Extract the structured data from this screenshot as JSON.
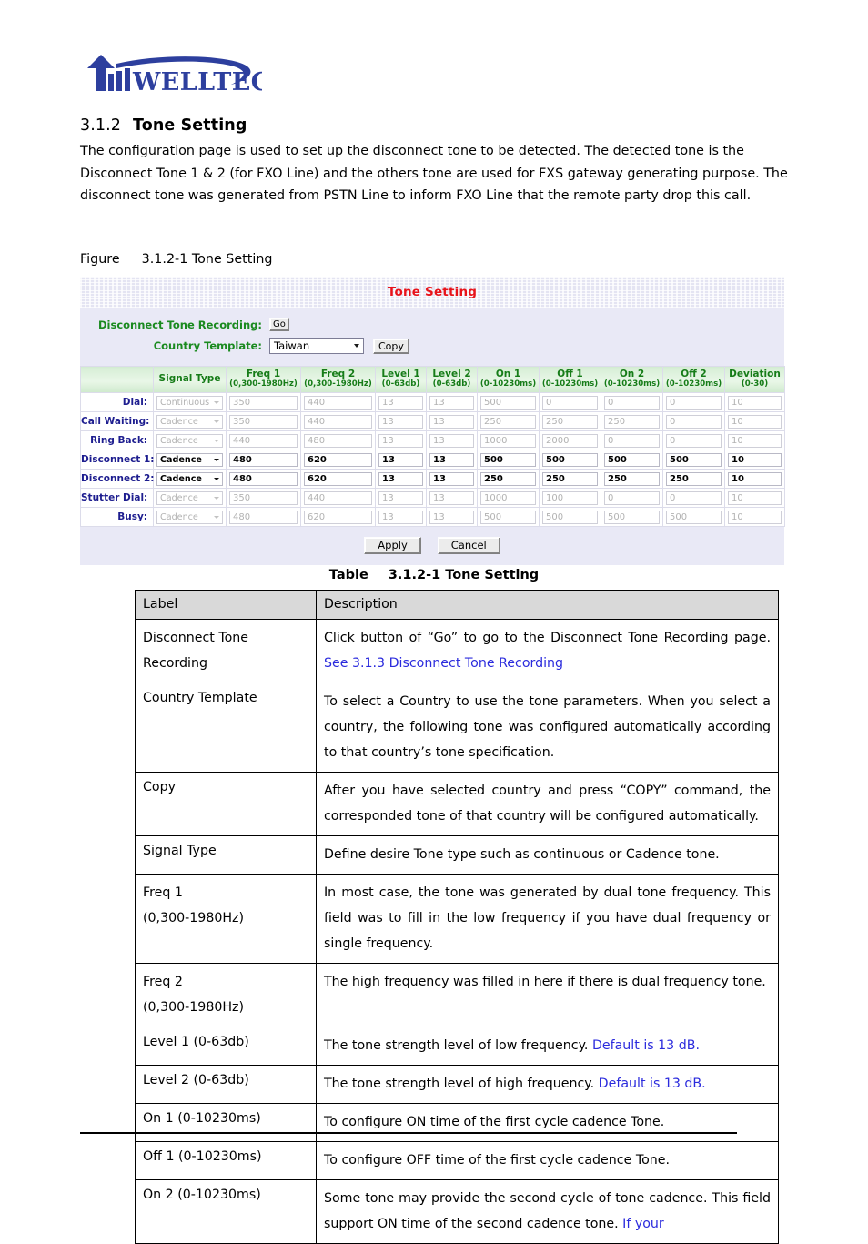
{
  "logo": {
    "text": "WELLTECH",
    "color": "#2d3f9e"
  },
  "section": {
    "number": "3.1.2",
    "title": "Tone Setting"
  },
  "intro": "The configuration page is used to set up the disconnect tone to be detected. The detected tone is the Disconnect Tone 1 & 2 (for FXO Line) and the others tone are used for FXS gateway generating purpose. The disconnect tone was generated from PSTN Line to inform FXO Line that the remote party drop this call.",
  "figure_caption": {
    "word": "Figure",
    "text": "3.1.2-1 Tone Setting"
  },
  "screenshot": {
    "title": "Tone Setting",
    "title_color": "#e8131a",
    "label_color": "#1a8a1f",
    "row_label_color": "#1d1d8f",
    "controls": {
      "disconnect_tone_recording_label": "Disconnect Tone Recording:",
      "go_button": "Go",
      "country_template_label": "Country Template:",
      "country_value": "Taiwan",
      "copy_button": "Copy"
    },
    "columns": [
      {
        "name": "Signal Type",
        "sub": ""
      },
      {
        "name": "Freq 1",
        "sub": "(0,300-1980Hz)"
      },
      {
        "name": "Freq 2",
        "sub": "(0,300-1980Hz)"
      },
      {
        "name": "Level 1",
        "sub": "(0-63db)"
      },
      {
        "name": "Level 2",
        "sub": "(0-63db)"
      },
      {
        "name": "On 1",
        "sub": "(0-10230ms)"
      },
      {
        "name": "Off 1",
        "sub": "(0-10230ms)"
      },
      {
        "name": "On 2",
        "sub": "(0-10230ms)"
      },
      {
        "name": "Off 2",
        "sub": "(0-10230ms)"
      },
      {
        "name": "Deviation",
        "sub": "(0-30)"
      }
    ],
    "rows": [
      {
        "label": "Dial:",
        "enabled": false,
        "signal": "Continuous",
        "freq1": "350",
        "freq2": "440",
        "level1": "13",
        "level2": "13",
        "on1": "500",
        "off1": "0",
        "on2": "0",
        "off2": "0",
        "dev": "10"
      },
      {
        "label": "Call Waiting:",
        "enabled": false,
        "signal": "Cadence",
        "freq1": "350",
        "freq2": "440",
        "level1": "13",
        "level2": "13",
        "on1": "250",
        "off1": "250",
        "on2": "250",
        "off2": "0",
        "dev": "10"
      },
      {
        "label": "Ring Back:",
        "enabled": false,
        "signal": "Cadence",
        "freq1": "440",
        "freq2": "480",
        "level1": "13",
        "level2": "13",
        "on1": "1000",
        "off1": "2000",
        "on2": "0",
        "off2": "0",
        "dev": "10"
      },
      {
        "label": "Disconnect 1:",
        "enabled": true,
        "signal": "Cadence",
        "freq1": "480",
        "freq2": "620",
        "level1": "13",
        "level2": "13",
        "on1": "500",
        "off1": "500",
        "on2": "500",
        "off2": "500",
        "dev": "10"
      },
      {
        "label": "Disconnect 2:",
        "enabled": true,
        "signal": "Cadence",
        "freq1": "480",
        "freq2": "620",
        "level1": "13",
        "level2": "13",
        "on1": "250",
        "off1": "250",
        "on2": "250",
        "off2": "250",
        "dev": "10"
      },
      {
        "label": "Stutter Dial:",
        "enabled": false,
        "signal": "Cadence",
        "freq1": "350",
        "freq2": "440",
        "level1": "13",
        "level2": "13",
        "on1": "1000",
        "off1": "100",
        "on2": "0",
        "off2": "0",
        "dev": "10"
      },
      {
        "label": "Busy:",
        "enabled": false,
        "signal": "Cadence",
        "freq1": "480",
        "freq2": "620",
        "level1": "13",
        "level2": "13",
        "on1": "500",
        "off1": "500",
        "on2": "500",
        "off2": "500",
        "dev": "10"
      }
    ],
    "apply_button": "Apply",
    "cancel_button": "Cancel"
  },
  "table_caption": {
    "word": "Table",
    "text": "3.1.2-1 Tone Setting"
  },
  "desc_table": {
    "headers": {
      "label": "Label",
      "description": "Description"
    },
    "rows": [
      {
        "label_line1": "Disconnect Tone",
        "label_line2": "Recording",
        "desc_pre": "Click button of “Go” to go to the Disconnect Tone Recording page. ",
        "desc_link": "See 3.1.3 Disconnect Tone Recording",
        "desc_post": ""
      },
      {
        "label_line1": "Country Template",
        "label_line2": "",
        "desc_pre": "To select a Country to use the tone parameters. When you select a country, the following tone was configured automatically according to that country’s tone specification.",
        "desc_link": "",
        "desc_post": ""
      },
      {
        "label_line1": "Copy",
        "label_line2": "",
        "desc_pre": "After you have selected country and press “COPY” command, the corresponded tone of that country will be configured automatically.",
        "desc_link": "",
        "desc_post": ""
      },
      {
        "label_line1": "Signal Type",
        "label_line2": "",
        "desc_pre": "Define desire Tone type such as continuous or Cadence tone.",
        "desc_link": "",
        "desc_post": ""
      },
      {
        "label_line1": "Freq 1",
        "label_line2": "(0,300-1980Hz)",
        "desc_pre": "In most case, the tone was generated by dual tone frequency. This field was to fill in the low frequency if you have dual frequency or single frequency.",
        "desc_link": "",
        "desc_post": ""
      },
      {
        "label_line1": "Freq 2",
        "label_line2": "(0,300-1980Hz)",
        "desc_pre": "The high frequency was filled in here if there is dual frequency tone.",
        "desc_link": "",
        "desc_post": ""
      },
      {
        "label_line1": "Level 1 (0-63db)",
        "label_line2": "",
        "desc_pre": "The tone strength level of low frequency. ",
        "desc_link": "Default is 13 dB.",
        "desc_post": ""
      },
      {
        "label_line1": "Level 2 (0-63db)",
        "label_line2": "",
        "desc_pre": "The tone strength level of high frequency. ",
        "desc_link": "Default is 13 dB.",
        "desc_post": ""
      },
      {
        "label_line1": "On 1 (0-10230ms)",
        "label_line2": "",
        "desc_pre": "To configure ON time of the first cycle cadence Tone.",
        "desc_link": "",
        "desc_post": ""
      },
      {
        "label_line1": "Off 1 (0-10230ms)",
        "label_line2": "",
        "desc_pre": "To configure OFF time of the first cycle cadence Tone.",
        "desc_link": "",
        "desc_post": ""
      },
      {
        "label_line1": "On 2 (0-10230ms)",
        "label_line2": "",
        "desc_pre": "Some tone may provide the second cycle of tone cadence. This field support ON time of the second cadence tone. ",
        "desc_link": "If your",
        "desc_post": ""
      }
    ]
  }
}
